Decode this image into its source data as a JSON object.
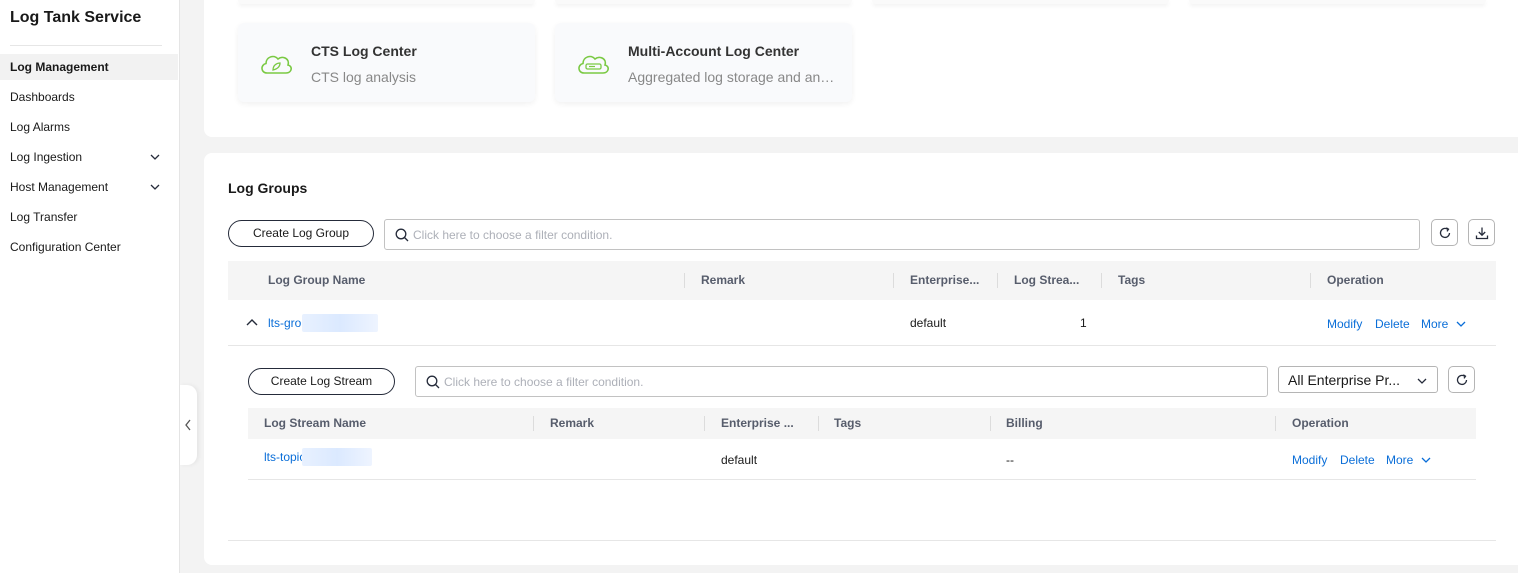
{
  "sidebar": {
    "title": "Log Tank Service",
    "items": [
      {
        "label": "Log Management",
        "active": true
      },
      {
        "label": "Dashboards"
      },
      {
        "label": "Log Alarms"
      },
      {
        "label": "Log Ingestion",
        "has_submenu": true
      },
      {
        "label": "Host Management",
        "has_submenu": true
      },
      {
        "label": "Log Transfer"
      },
      {
        "label": "Configuration Center"
      }
    ]
  },
  "cards": [
    {
      "title": "CTS Log Center",
      "desc": "CTS log analysis",
      "icon": "cloud-leaf-icon"
    },
    {
      "title": "Multi-Account Log Center",
      "desc": "Aggregated log storage and analysis",
      "icon": "cloud-storage-icon"
    }
  ],
  "colors": {
    "accent": "#0a6ed8",
    "icon_green": "#7ac943",
    "text": "#191919"
  },
  "log_groups": {
    "title": "Log Groups",
    "create_label": "Create Log Group",
    "search_placeholder": "Click here to choose a filter condition.",
    "columns": [
      "Log Group Name",
      "Remark",
      "Enterprise...",
      "Log Strea...",
      "Tags",
      "Operation"
    ],
    "row": {
      "name": "lts-gro",
      "remark": "",
      "enterprise": "default",
      "streams": "1",
      "tags": "",
      "ops": [
        "Modify",
        "Delete",
        "More"
      ]
    }
  },
  "log_streams": {
    "create_label": "Create Log Stream",
    "search_placeholder": "Click here to choose a filter condition.",
    "project_select": "All Enterprise Pr...",
    "columns": [
      "Log Stream Name",
      "Remark",
      "Enterprise ...",
      "Tags",
      "Billing",
      "Operation"
    ],
    "row": {
      "name": "lts-topic",
      "remark": "",
      "enterprise": "default",
      "tags": "",
      "billing": "--",
      "ops": [
        "Modify",
        "Delete",
        "More"
      ]
    }
  }
}
